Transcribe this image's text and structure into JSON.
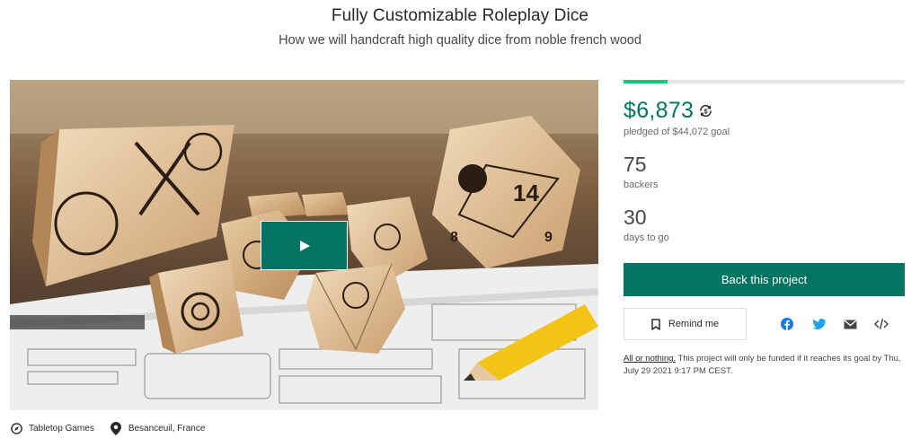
{
  "project": {
    "title": "Fully Customizable Roleplay Dice",
    "subtitle": "How we will handcraft high quality dice from noble french wood"
  },
  "media": {
    "play_icon": "play-icon"
  },
  "meta": {
    "category": "Tabletop Games",
    "category_icon": "compass-icon",
    "location": "Besanceuil, France",
    "location_icon": "map-pin-icon"
  },
  "stats": {
    "progress_fraction": 0.156,
    "pledged": "$6,873",
    "pledged_label": "pledged of $44,072 goal",
    "backers": "75",
    "backers_label": "backers",
    "days": "30",
    "days_label": "days to go"
  },
  "actions": {
    "back_label": "Back this project",
    "remind_label": "Remind me"
  },
  "share": {
    "icons": [
      "facebook-icon",
      "twitter-icon",
      "email-icon",
      "embed-icon"
    ]
  },
  "notice": {
    "link": "All or nothing.",
    "text": " This project will only be funded if it reaches its goal by Thu, July 29 2021 9:17 PM CEST."
  },
  "colors": {
    "brand_green": "#037362",
    "progress_green": "#05ce78",
    "facebook": "#1877f2",
    "twitter": "#1da1f2"
  }
}
